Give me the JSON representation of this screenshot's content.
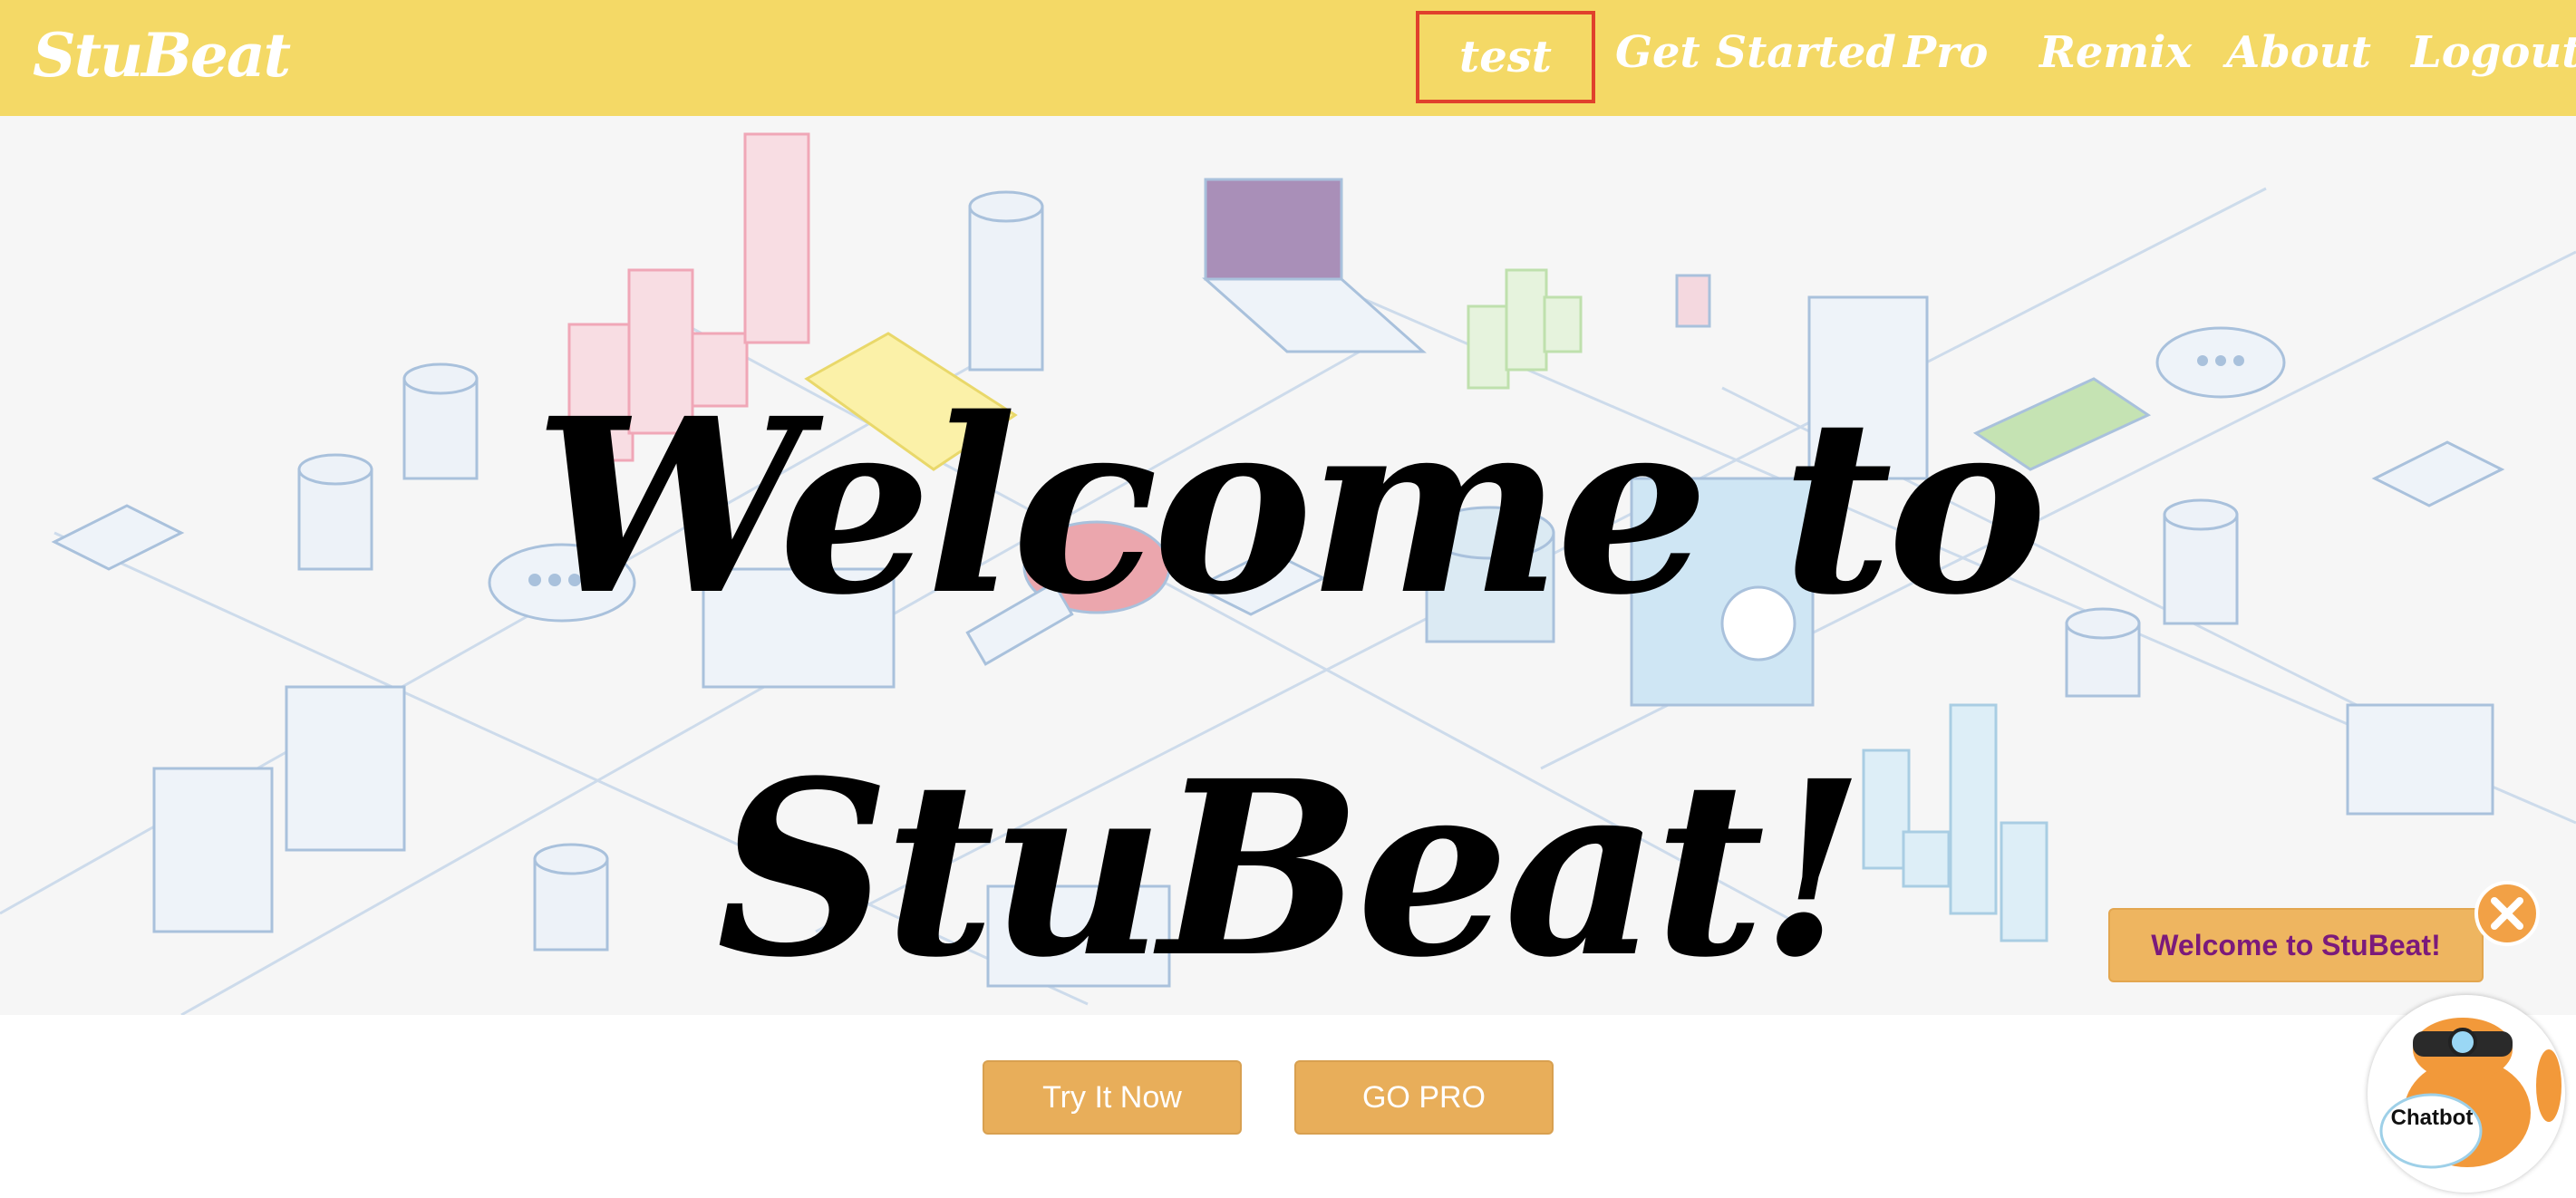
{
  "nav": {
    "brand": "StuBeat",
    "links": [
      "test",
      "Get Started",
      "Pro",
      "Remix",
      "About",
      "Logout"
    ],
    "active_link": "test"
  },
  "hero": {
    "title_line1": "Welcome to",
    "title_line2": "StuBeat!"
  },
  "cta": {
    "try_label": "Try It Now",
    "pro_label": "GO PRO"
  },
  "chat": {
    "greeting": "Welcome to StuBeat!",
    "avatar_label": "Chatbot",
    "close_icon": "close-icon"
  },
  "colors": {
    "nav_bg": "#f4d966",
    "button_bg": "#e8ae5a",
    "active_border": "#e0402c",
    "greeting_text": "#7b1a7b"
  }
}
